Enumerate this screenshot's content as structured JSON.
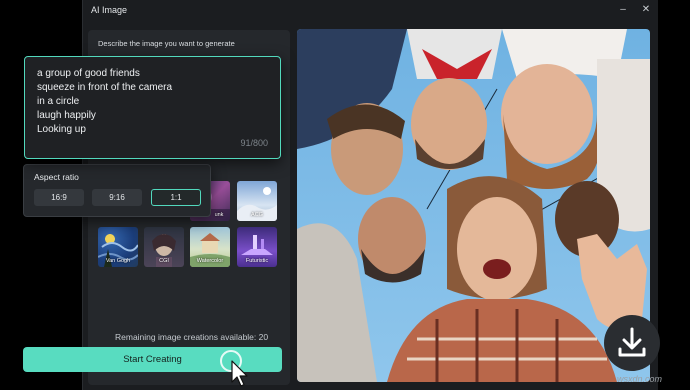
{
  "window": {
    "title": "AI Image"
  },
  "prompt": {
    "label": "Describe the image you want to generate",
    "lines": [
      "a group of good friends",
      "squeeze in front of the camera",
      "in a circle",
      "laugh happily",
      "Looking up"
    ],
    "counter": "91/800"
  },
  "aspect": {
    "title": "Aspect ratio",
    "options": [
      "16:9",
      "9:16",
      "1:1"
    ],
    "selected": "1:1"
  },
  "styles": [
    {
      "label": "unk",
      "icon": "style-partial-icon"
    },
    {
      "label": "ACG",
      "icon": "style-acg-icon"
    },
    {
      "label": "Van Gogh",
      "icon": "style-van-gogh-icon"
    },
    {
      "label": "CGI",
      "icon": "style-cgi-icon"
    },
    {
      "label": "Watercolor",
      "icon": "style-watercolor-icon"
    },
    {
      "label": "Futuristic",
      "icon": "style-futuristic-icon"
    }
  ],
  "remaining": "Remaining image creations available: 20",
  "start_button": "Start Creating",
  "watermark": "wsxdn.com",
  "colors": {
    "accent": "#52d9bd",
    "background": "#1b1d20",
    "panel": "#25282c"
  }
}
